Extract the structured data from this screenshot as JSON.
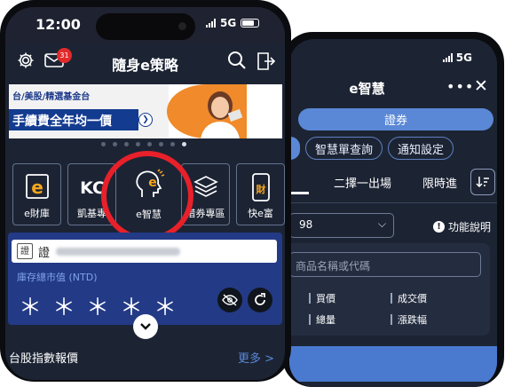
{
  "back_phone": {
    "status": {
      "network": "5G"
    },
    "title": "e智慧",
    "more_icon": "more-horizontal-icon",
    "close_icon": "close-icon",
    "segment": "證券",
    "pills": [
      "",
      "智慧單查詢",
      "通知設定"
    ],
    "tabs": [
      "",
      "二擇一出場",
      "限時進"
    ],
    "sort_icon": "sort-icon",
    "account_select": "98",
    "help_label": "功能說明",
    "search_placeholder": "商品名稱或代碼",
    "quote_fields": [
      [
        "買價",
        "成交價"
      ],
      [
        "總量",
        "漲跌幅"
      ]
    ]
  },
  "front_phone": {
    "status": {
      "time": "12:00",
      "network": "5G"
    },
    "header": {
      "title": "隨身e策略",
      "badge_count": "31"
    },
    "banner": {
      "small_text": "台/美股/精選基金台",
      "main_text": "手續費全年均一價"
    },
    "carousel": {
      "count": 8,
      "active": 7
    },
    "icon_tiles": [
      {
        "label": "e財庫",
        "icon": "e-wealth-icon"
      },
      {
        "label": "凱基專",
        "icon": "kgi-logo-icon"
      },
      {
        "label": "e智慧",
        "icon": "smart-head-icon"
      },
      {
        "label": "借券專區",
        "icon": "stock-lending-icon"
      },
      {
        "label": "快e富",
        "icon": "phone-wealth-icon"
      }
    ],
    "account": {
      "tag": "證",
      "label": "證",
      "value_label": "庫存總市值 (NTD)",
      "masked_value": "＊＊＊＊＊"
    },
    "index_section": {
      "title": "台股指數報價",
      "more": "更多 >"
    }
  },
  "colors": {
    "screen_bg": "#1c2434",
    "accent_blue": "#5a88d6",
    "account_card": "#233a86",
    "highlight_red": "#e8202a"
  }
}
